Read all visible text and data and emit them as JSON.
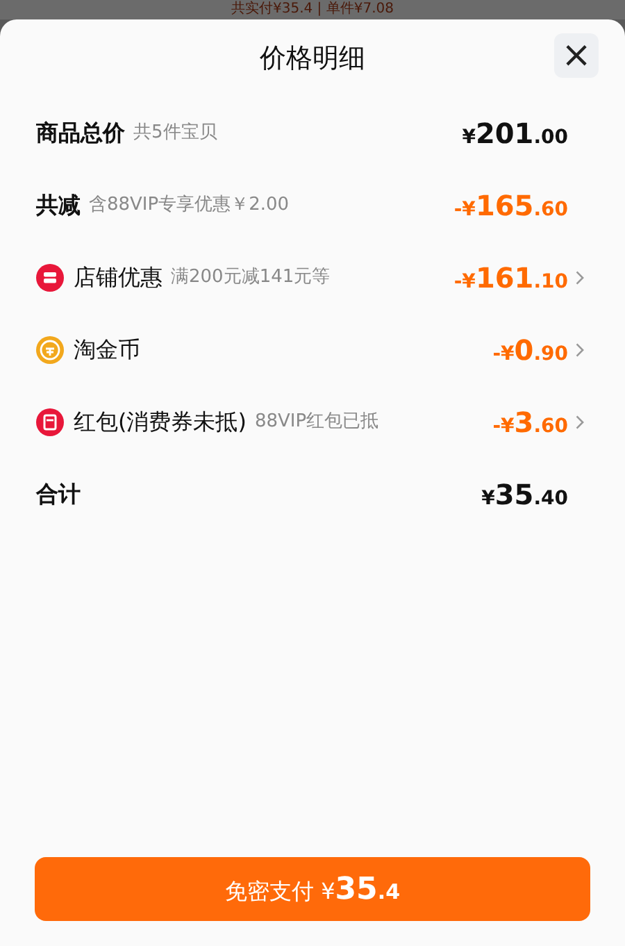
{
  "backdrop": {
    "text": "共实付¥35.4 | 单件¥7.08"
  },
  "sheet": {
    "title": "价格明细",
    "close": "×"
  },
  "rows": [
    {
      "kind": "total",
      "label": "商品总价",
      "note": "共5件宝贝",
      "amount": {
        "prefix": "¥",
        "integer": "201",
        "decimal": ".00"
      },
      "chevron": false
    },
    {
      "kind": "discount",
      "label": "共减",
      "note": "含88VIP专享优惠￥2.00",
      "amount": {
        "prefix": "-¥",
        "integer": "165",
        "decimal": ".60"
      },
      "chevron": false
    },
    {
      "kind": "shop",
      "label": "店铺优惠",
      "note": "满200元减141元等",
      "amount": {
        "prefix": "-¥",
        "integer": "161",
        "decimal": ".10"
      },
      "chevron": true
    },
    {
      "kind": "coin",
      "label": "淘金币",
      "amount": {
        "prefix": "-¥",
        "integer": "0",
        "decimal": ".90"
      },
      "chevron": true
    },
    {
      "kind": "redpacket",
      "label": "红包(消费券未抵)",
      "note": "88VIP红包已抵",
      "amount": {
        "prefix": "-¥",
        "integer": "3",
        "decimal": ".60"
      },
      "chevron": true
    },
    {
      "kind": "total",
      "label": "合计",
      "amount": {
        "prefix": "¥",
        "integer": "35",
        "decimal": ".40"
      },
      "chevron": false
    }
  ],
  "pay_button": {
    "label": "免密支付",
    "prefix": "¥",
    "integer": "35",
    "decimal": ".4"
  }
}
